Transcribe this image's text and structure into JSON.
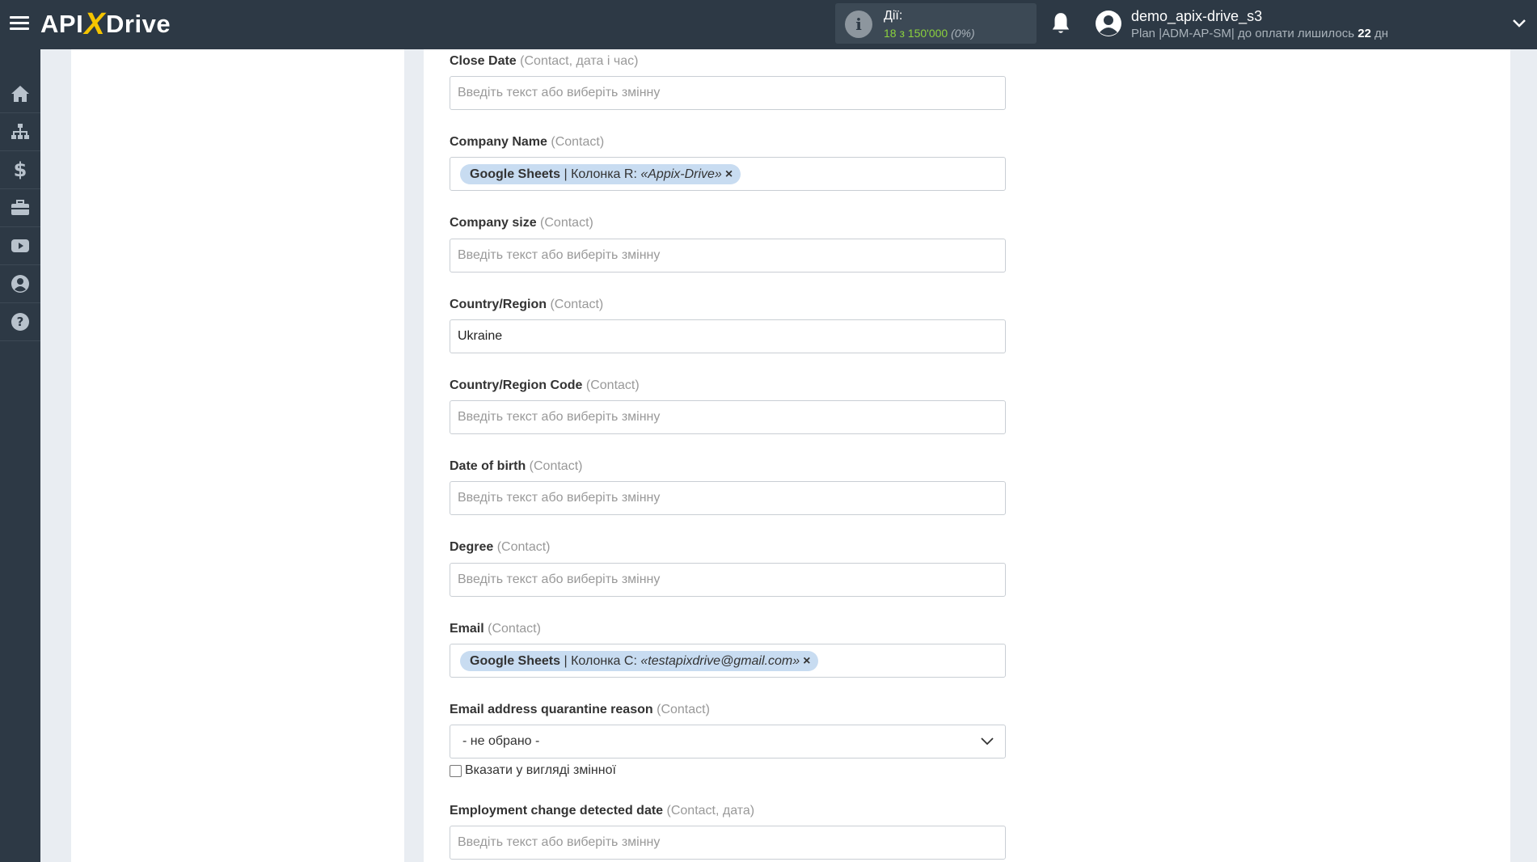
{
  "header": {
    "logo_left": "API",
    "logo_x": "X",
    "logo_right": "Drive",
    "actions_label": "Дії:",
    "actions_used": "18",
    "actions_sep": " з ",
    "actions_limit": "150'000",
    "actions_percent": "(0%)",
    "user_name": "demo_apix-drive_s3",
    "plan_text": "Plan |ADM-AP-SM| до оплати лишилось ",
    "plan_days": "22",
    "plan_days_unit": " дн"
  },
  "sidebar": {
    "items": [
      {
        "icon": "home-icon"
      },
      {
        "icon": "sitemap-icon"
      },
      {
        "icon": "dollar-icon"
      },
      {
        "icon": "briefcase-icon"
      },
      {
        "icon": "youtube-icon"
      },
      {
        "icon": "user-circle-icon"
      },
      {
        "icon": "help-icon"
      }
    ]
  },
  "form": {
    "placeholder": "Введіть текст або виберіть змінну",
    "fields": [
      {
        "label": "Close Date",
        "hint": "(Contact, дата і час)"
      },
      {
        "label": "Company Name",
        "hint": "(Contact)",
        "tag_source": "Google Sheets",
        "tag_column": " | Колонка R: ",
        "tag_value": "«Appix-Drive»",
        "tag_remove": "×"
      },
      {
        "label": "Company size",
        "hint": "(Contact)"
      },
      {
        "label": "Country/Region",
        "hint": "(Contact)",
        "value": "Ukraine"
      },
      {
        "label": "Country/Region Code",
        "hint": "(Contact)"
      },
      {
        "label": "Date of birth",
        "hint": "(Contact)"
      },
      {
        "label": "Degree",
        "hint": "(Contact)"
      },
      {
        "label": "Email",
        "hint": "(Contact)",
        "tag_source": "Google Sheets",
        "tag_column": " | Колонка C: ",
        "tag_value": "«testapixdrive@gmail.com»",
        "tag_remove": "×"
      },
      {
        "label": "Email address quarantine reason",
        "hint": "(Contact)",
        "select_value": "- не обрано -",
        "checkbox_label": "Вказати у вигляді змінної"
      },
      {
        "label": "Employment change detected date",
        "hint": "(Contact, дата)"
      }
    ]
  },
  "colors": {
    "topbar": "#2d3945",
    "accent_yellow": "#f4c400",
    "counter_green": "#8bd13d",
    "tag_bg": "#c8dcf1"
  }
}
